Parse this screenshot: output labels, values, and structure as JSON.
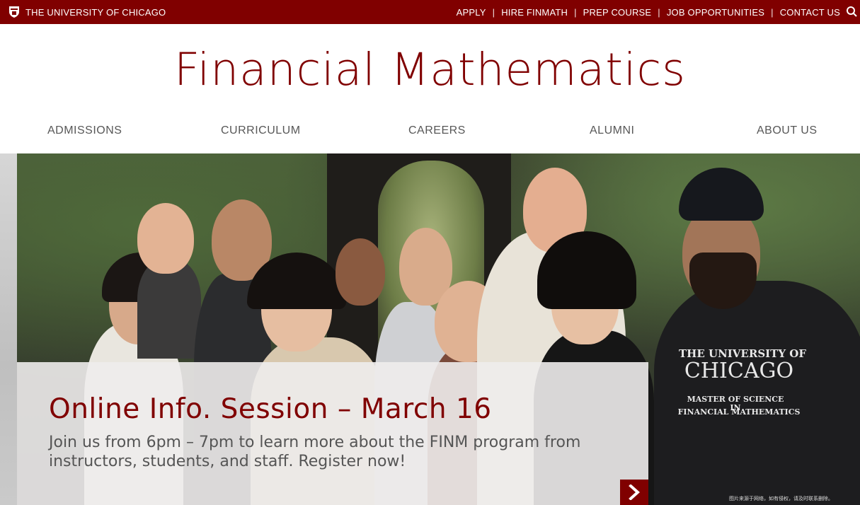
{
  "topbar": {
    "brand": "THE UNIVERSITY OF CHICAGO",
    "links": [
      "APPLY",
      "HIRE FINMATH",
      "PREP COURSE",
      "JOB OPPORTUNITIES",
      "CONTACT US"
    ],
    "separator": "|"
  },
  "site_title": "Financial Mathematics",
  "main_nav": [
    "ADMISSIONS",
    "CURRICULUM",
    "CAREERS",
    "ALUMNI",
    "ABOUT US"
  ],
  "hero": {
    "shirt_text_line1": "THE UNIVERSITY OF",
    "shirt_text_line2": "CHICAGO",
    "shirt_text_line3": "MASTER OF SCIENCE IN",
    "shirt_text_line4": "FINANCIAL MATHEMATICS",
    "caption_title": "Online Info. Session – March 16",
    "caption_text": "Join us from 6pm – 7pm to learn more about the FINM program from instructors, students, and staff. Register now!",
    "watermark": "图片来源于网络，如有侵权，请及时联系删除。"
  },
  "colors": {
    "brand_maroon": "#800000",
    "nav_text": "#575757",
    "caption_bg": "#eeecec"
  }
}
